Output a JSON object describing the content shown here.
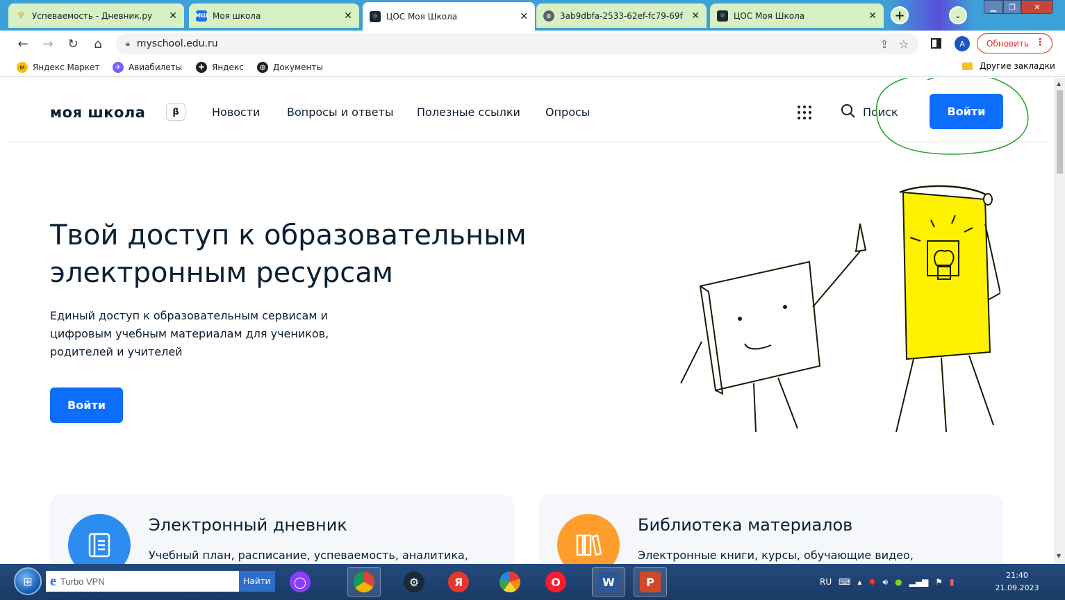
{
  "browser": {
    "tabs": [
      {
        "title": "Успеваемость - Дневник.ру",
        "favicon": "dnevnik-icon",
        "favicon_color": "#f5a623",
        "active": false
      },
      {
        "title": "Моя школа",
        "favicon": "mysch-icon",
        "favicon_label": "МШ",
        "favicon_color": "#1a73e8",
        "active": false
      },
      {
        "title": "ЦОС Моя Школа",
        "favicon": "react-icon",
        "favicon_color": "#20232a",
        "active": true
      },
      {
        "title": "3ab9dbfa-2533-62ef-fc79-69f",
        "favicon": "globe-icon",
        "favicon_color": "#5f6368",
        "active": false
      },
      {
        "title": "ЦОС Моя Школа",
        "favicon": "react-icon",
        "favicon_color": "#20232a",
        "active": false
      }
    ],
    "url": "myschool.edu.ru",
    "update_label": "Обновить",
    "avatar_letter": "A",
    "bookmarks": [
      {
        "label": "Яндекс Маркет",
        "icon": "market-icon",
        "color": "#f7c300"
      },
      {
        "label": "Авиабилеты",
        "icon": "plane-icon",
        "color": "#7a5cff"
      },
      {
        "label": "Яндекс",
        "icon": "yandex-icon",
        "color": "#202124"
      },
      {
        "label": "Документы",
        "icon": "globe-icon",
        "color": "#202124"
      }
    ],
    "other_bookmarks": "Другие закладки"
  },
  "site": {
    "logo": "моя школа",
    "beta": "β",
    "nav": [
      "Новости",
      "Вопросы и ответы",
      "Полезные ссылки",
      "Опросы"
    ],
    "search_label": "Поиск",
    "login_label": "Войти",
    "hero_title": "Твой доступ к образовательным электронным ресурсам",
    "hero_subtitle": "Единый доступ к образовательным сервисам и цифровым учебным материалам для учеников, родителей и учителей",
    "hero_login": "Войти",
    "cards": [
      {
        "title": "Электронный дневник",
        "desc": "Учебный план, расписание, успеваемость, аналитика,",
        "color": "#2d8cf0",
        "icon": "diary-icon"
      },
      {
        "title": "Библиотека материалов",
        "desc": "Электронные книги, курсы, обучающие видео,",
        "color": "#ff9e2c",
        "icon": "books-icon"
      }
    ],
    "accent": "#0d6efd"
  },
  "taskbar": {
    "search_text": "Turbo VPN",
    "search_button": "Найти",
    "lang": "RU",
    "time": "21:40",
    "date": "21.09.2023"
  }
}
